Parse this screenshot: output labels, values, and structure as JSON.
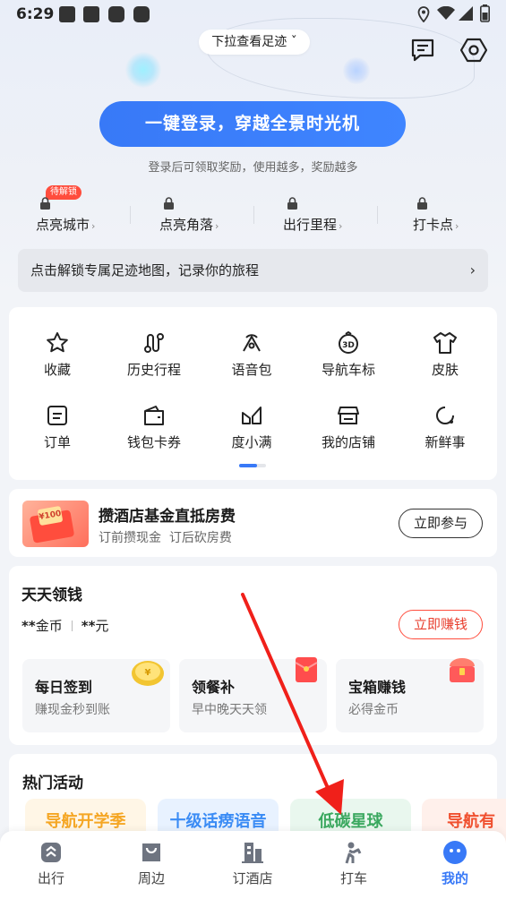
{
  "status_bar": {
    "time": "6:29"
  },
  "header": {
    "pull_hint": "下拉查看足迹"
  },
  "login": {
    "button": "一键登录，穿越全景时光机",
    "subtitle": "登录后可领取奖励，使用越多，奖励越多"
  },
  "stats": {
    "badge": "待解锁",
    "items": [
      {
        "label": "点亮城市"
      },
      {
        "label": "点亮角落"
      },
      {
        "label": "出行里程"
      },
      {
        "label": "打卡点"
      }
    ]
  },
  "unlock_bar": {
    "text": "点击解锁专属足迹地图，记录你的旅程"
  },
  "grid": {
    "items": [
      {
        "label": "收藏",
        "icon": "star-icon"
      },
      {
        "label": "历史行程",
        "icon": "route-icon"
      },
      {
        "label": "语音包",
        "icon": "voice-pack-icon"
      },
      {
        "label": "导航车标",
        "icon": "3d-car-icon"
      },
      {
        "label": "皮肤",
        "icon": "shirt-icon"
      },
      {
        "label": "订单",
        "icon": "order-icon"
      },
      {
        "label": "钱包卡券",
        "icon": "wallet-icon"
      },
      {
        "label": "度小满",
        "icon": "duxiaoman-icon"
      },
      {
        "label": "我的店铺",
        "icon": "shop-icon"
      },
      {
        "label": "新鲜事",
        "icon": "refresh-icon"
      }
    ]
  },
  "hotel_promo": {
    "image_text": "¥100",
    "title": "攒酒店基金直抵房费",
    "subtitle": "订前攒现金  订后砍房费",
    "button": "立即参与"
  },
  "earn": {
    "title": "天天领钱",
    "coins_value": "**",
    "coins_unit": "金币",
    "cash_value": "**",
    "cash_unit": "元",
    "button": "立即赚钱",
    "tasks": [
      {
        "title": "每日签到",
        "subtitle": "赚现金秒到账"
      },
      {
        "title": "领餐补",
        "subtitle": "早中晚天天领"
      },
      {
        "title": "宝箱赚钱",
        "subtitle": "必得金币"
      }
    ]
  },
  "hot": {
    "title": "热门活动",
    "chips": [
      {
        "label": "导航开学季",
        "color": "#f5a623",
        "bg": "#fff6e6"
      },
      {
        "label": "十级话痨语音",
        "color": "#3b8cf5",
        "bg": "#e8f2ff"
      },
      {
        "label": "低碳星球",
        "color": "#3aa85f",
        "bg": "#e9f7ee"
      },
      {
        "label": "导航有",
        "color": "#f0502f",
        "bg": "#fff0eb"
      }
    ]
  },
  "tabbar": {
    "items": [
      {
        "label": "出行"
      },
      {
        "label": "周边"
      },
      {
        "label": "订酒店"
      },
      {
        "label": "打车"
      },
      {
        "label": "我的"
      }
    ]
  },
  "colors": {
    "accent": "#3879f7",
    "red": "#ff4d3d",
    "annotation_arrow": "#f0201a"
  }
}
